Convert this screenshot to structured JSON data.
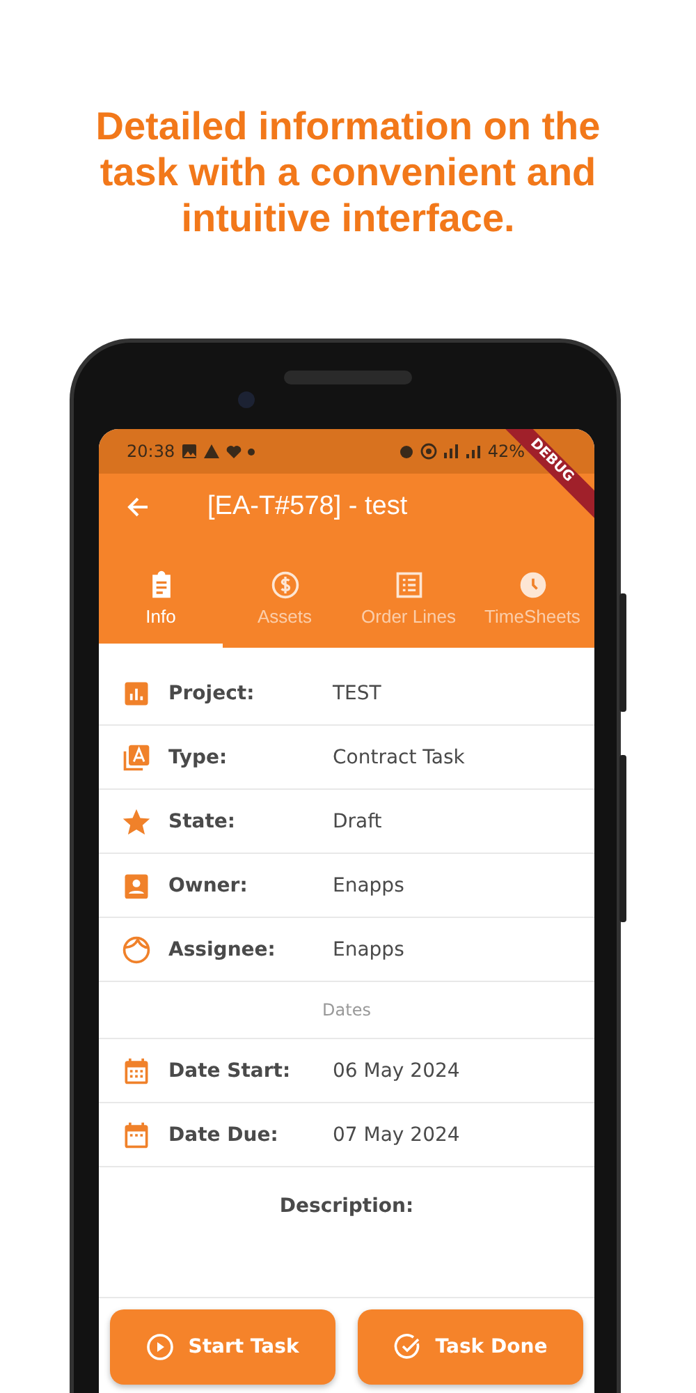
{
  "headline": "Detailed information on the task with a convenient and intuitive interface.",
  "status_bar": {
    "time": "20:38",
    "battery": "42%"
  },
  "debug_banner": "DEBUG",
  "app_bar": {
    "title": "[EA-T#578] - test"
  },
  "tabs": [
    {
      "label": "Info",
      "selected": true
    },
    {
      "label": "Assets",
      "selected": false
    },
    {
      "label": "Order Lines",
      "selected": false
    },
    {
      "label": "TimeSheets",
      "selected": false
    }
  ],
  "rows": [
    {
      "kind": "field",
      "label": "Project:",
      "value": "TEST"
    },
    {
      "kind": "field",
      "label": "Type:",
      "value": "Contract Task"
    },
    {
      "kind": "field",
      "label": "State:",
      "value": "Draft"
    },
    {
      "kind": "field",
      "label": "Owner:",
      "value": "Enapps"
    },
    {
      "kind": "field",
      "label": "Assignee:",
      "value": "Enapps"
    },
    {
      "kind": "header",
      "label": "Dates"
    },
    {
      "kind": "field",
      "label": "Date Start:",
      "value": "06 May 2024"
    },
    {
      "kind": "field",
      "label": "Date Due:",
      "value": "07 May 2024"
    }
  ],
  "description": {
    "label": "Description:"
  },
  "buttons": [
    {
      "label": "Start Task"
    },
    {
      "label": "Task Done"
    }
  ]
}
